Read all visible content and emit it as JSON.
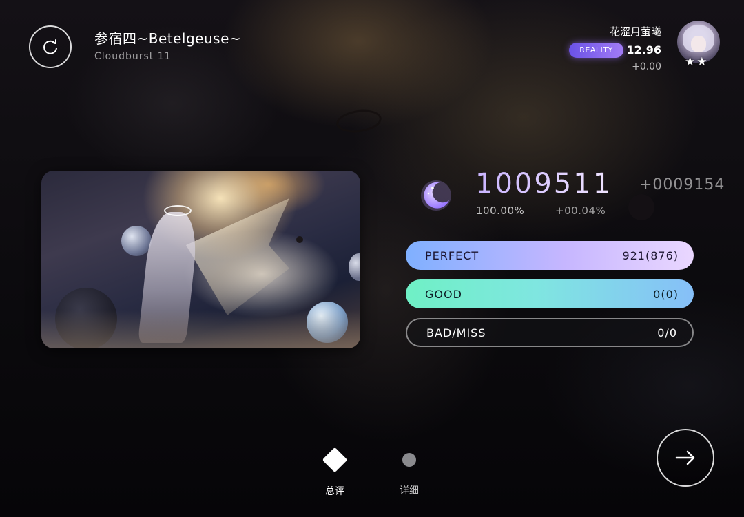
{
  "song": {
    "title": "参宿四~Betelgeuse~",
    "difficulty": "Cloudburst 11"
  },
  "player": {
    "name": "花涩月萤曦",
    "rank_badge": "REALITY",
    "rks": "12.96",
    "rks_delta": "+0.00",
    "stars": "★★",
    "avatar_icon": "avatar-portrait"
  },
  "result": {
    "score": "1009511",
    "score_delta": "+0009154",
    "accuracy": "100.00%",
    "accuracy_delta": "+00.04%",
    "grade_icon": "crescent-moon-icon",
    "grade_color": "#a98bff"
  },
  "judgements": [
    {
      "label": "PERFECT",
      "value": "921(876)"
    },
    {
      "label": "GOOD",
      "value": "0(0)"
    },
    {
      "label": "BAD/MISS",
      "value": "0/0"
    }
  ],
  "tabs": [
    {
      "label": "总评",
      "icon": "diamond-icon",
      "active": true
    },
    {
      "label": "详细",
      "icon": "dot-icon",
      "active": false
    }
  ],
  "buttons": {
    "retry_icon": "retry-icon",
    "next_icon": "arrow-right-icon"
  },
  "colors": {
    "perfect_gradient": [
      "#7fb0ff",
      "#ead7ff"
    ],
    "good_gradient": [
      "#6ff0c5",
      "#86bff8"
    ],
    "badge": "#7c62ee"
  }
}
